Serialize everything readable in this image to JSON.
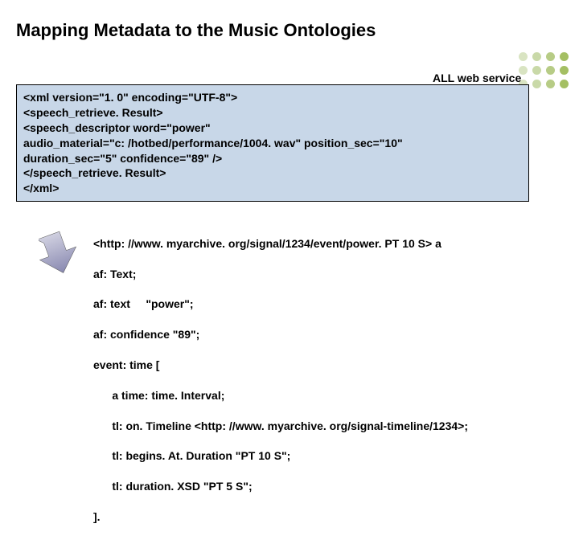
{
  "title": "Mapping Metadata to the Music Ontologies",
  "label": "ALL web service output",
  "xml": {
    "l1": "<xml version=\"1. 0\" encoding=\"UTF-8\">",
    "l2": "<speech_retrieve. Result>",
    "l3": " <speech_descriptor word=\"power\"",
    "l4": "audio_material=\"c: /hotbed/performance/1004. wav\" position_sec=\"10\"",
    "l5": "duration_sec=\"5\" confidence=\"89\" />",
    "l6": " </speech_retrieve. Result>",
    "l7": "</xml>"
  },
  "rdf": {
    "l1": "<http: //www. myarchive. org/signal/1234/event/power. PT 10 S> a",
    "l2": "af: Text;",
    "l3": "af: text     \"power\";",
    "l4": "af: confidence \"89\";",
    "l5": "event: time [",
    "l6": "      a time: time. Interval;",
    "l7": "      tl: on. Timeline <http: //www. myarchive. org/signal-timeline/1234>;",
    "l8": "      tl: begins. At. Duration \"PT 10 S\";",
    "l9": "      tl: duration. XSD \"PT 5 S\";",
    "l10": "]."
  },
  "dot_colors": [
    "#d9e4c2",
    "#c9d9a8",
    "#b7cc86",
    "#a4bf63",
    "#d9e4c2",
    "#c9d9a8",
    "#b7cc86",
    "#a4bf63",
    "#d9e4c2",
    "#c9d9a8",
    "#b7cc86",
    "#a4bf63"
  ]
}
